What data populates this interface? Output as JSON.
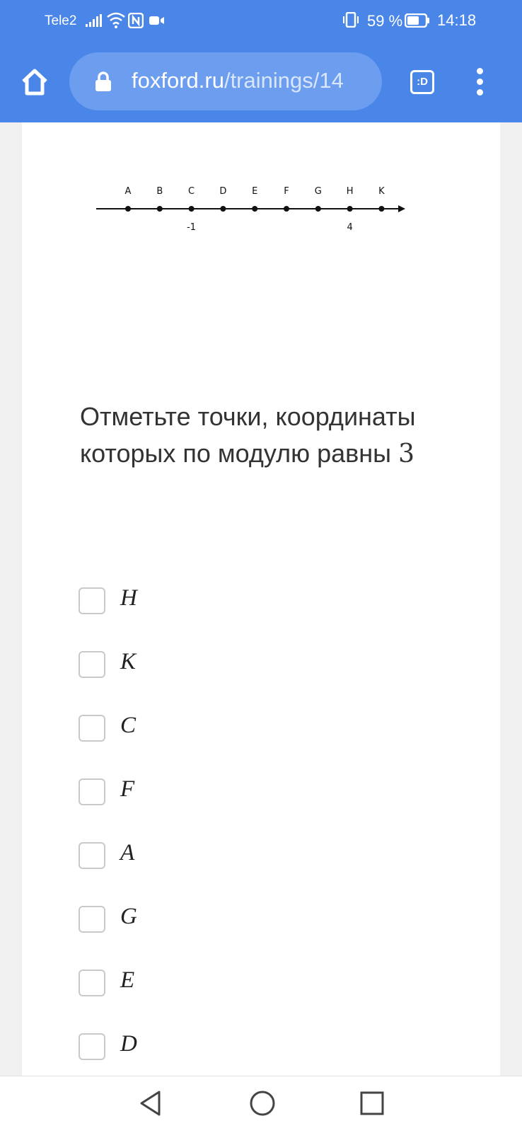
{
  "status_bar": {
    "carrier": "Tele2",
    "battery_percent": "59 %",
    "time": "14:18"
  },
  "browser": {
    "url_domain": "foxford.ru",
    "url_path": "/trainings/14",
    "tab_label": ":D",
    "icons": [
      "home-icon",
      "lock-icon",
      "tab-switcher-icon",
      "menu-icon"
    ]
  },
  "number_line": {
    "points": [
      "A",
      "B",
      "C",
      "D",
      "E",
      "F",
      "G",
      "H",
      "K"
    ],
    "labels": [
      {
        "point": "C",
        "value": "-1"
      },
      {
        "point": "H",
        "value": "4"
      }
    ]
  },
  "question": {
    "text": "Отметьте точки, координаты которых по модулю равны",
    "number": "3"
  },
  "options": [
    {
      "label": "H",
      "checked": false
    },
    {
      "label": "K",
      "checked": false
    },
    {
      "label": "C",
      "checked": false
    },
    {
      "label": "F",
      "checked": false
    },
    {
      "label": "A",
      "checked": false
    },
    {
      "label": "G",
      "checked": false
    },
    {
      "label": "E",
      "checked": false
    },
    {
      "label": "D",
      "checked": false
    }
  ],
  "colors": {
    "accent": "#4a86e8",
    "url_bar": "#6c9def",
    "text": "#333333",
    "checkbox_border": "#c9c9c9"
  }
}
